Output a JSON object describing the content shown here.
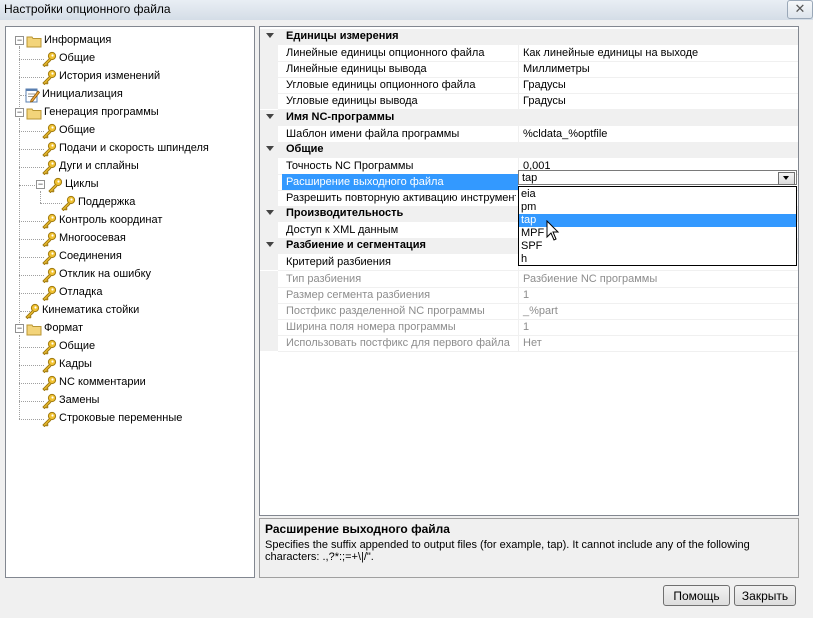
{
  "window": {
    "title": "Настройки опционного файла",
    "close_glyph": "✕"
  },
  "tree": {
    "nodes": [
      {
        "label": "Информация",
        "level": 0,
        "expander": "−",
        "icon": "folder-icon"
      },
      {
        "label": "Общие",
        "level": 1,
        "icon": "key-icon"
      },
      {
        "label": "История изменений",
        "level": 1,
        "icon": "key-icon"
      },
      {
        "label": "Инициализация",
        "level": 0,
        "icon": "notepad-icon"
      },
      {
        "label": "Генерация программы",
        "level": 0,
        "expander": "−",
        "icon": "folder-icon"
      },
      {
        "label": "Общие",
        "level": 1,
        "icon": "key-icon"
      },
      {
        "label": "Подачи и скорость шпинделя",
        "level": 1,
        "icon": "key-icon"
      },
      {
        "label": "Дуги и сплайны",
        "level": 1,
        "icon": "key-icon"
      },
      {
        "label": "Циклы",
        "level": 1,
        "expander": "−",
        "icon": "key-icon"
      },
      {
        "label": "Поддержка",
        "level": 2,
        "icon": "key-icon"
      },
      {
        "label": "Контроль координат",
        "level": 1,
        "icon": "key-icon"
      },
      {
        "label": "Многоосевая",
        "level": 1,
        "icon": "key-icon"
      },
      {
        "label": "Соединения",
        "level": 1,
        "icon": "key-icon"
      },
      {
        "label": "Отклик на ошибку",
        "level": 1,
        "icon": "key-icon"
      },
      {
        "label": "Отладка",
        "level": 1,
        "icon": "key-icon"
      },
      {
        "label": "Кинематика стойки",
        "level": 0,
        "icon": "key-icon"
      },
      {
        "label": "Формат",
        "level": 0,
        "expander": "−",
        "icon": "folder-icon"
      },
      {
        "label": "Общие",
        "level": 1,
        "icon": "key-icon"
      },
      {
        "label": "Кадры",
        "level": 1,
        "icon": "key-icon"
      },
      {
        "label": "NC комментарии",
        "level": 1,
        "icon": "key-icon"
      },
      {
        "label": "Замены",
        "level": 1,
        "icon": "key-icon"
      },
      {
        "label": "Строковые переменные",
        "level": 1,
        "icon": "key-icon"
      }
    ]
  },
  "grid": {
    "rows": [
      {
        "kind": "cat",
        "label": "Единицы измерения"
      },
      {
        "kind": "prop",
        "name": "Линейные единицы опционного файла",
        "value": "Как линейные единицы на выходе"
      },
      {
        "kind": "prop",
        "name": "Линейные единицы вывода",
        "value": "Миллиметры"
      },
      {
        "kind": "prop",
        "name": "Угловые единицы опционного файла",
        "value": "Градусы"
      },
      {
        "kind": "prop",
        "name": "Угловые единицы вывода",
        "value": "Градусы"
      },
      {
        "kind": "cat",
        "label": "Имя NC-программы"
      },
      {
        "kind": "prop",
        "name": "Шаблон имени файла программы",
        "value": "%cldata_%optfile"
      },
      {
        "kind": "cat",
        "label": "Общие"
      },
      {
        "kind": "prop",
        "name": "Точность NC Программы",
        "value": "0,001"
      },
      {
        "kind": "prop",
        "name": "Расширение выходного файла",
        "value": "tap",
        "selected": true
      },
      {
        "kind": "prop",
        "name": "Разрешить повторную активацию инструмента",
        "value": ""
      },
      {
        "kind": "cat",
        "label": "Производительность"
      },
      {
        "kind": "prop",
        "name": "Доступ к XML данным",
        "value": ""
      },
      {
        "kind": "cat",
        "label": "Разбиение и сегментация"
      },
      {
        "kind": "prop",
        "name": "Критерий разбиения",
        "value": ""
      },
      {
        "kind": "prop",
        "name": "Тип разбиения",
        "value": "Разбиение NC программы",
        "disabled": true
      },
      {
        "kind": "prop",
        "name": "Размер сегмента разбиения",
        "value": "1",
        "disabled": true
      },
      {
        "kind": "prop",
        "name": "Постфикс разделенной NC программы",
        "value": "_%part",
        "disabled": true
      },
      {
        "kind": "prop",
        "name": "Ширина поля номера программы",
        "value": "1",
        "disabled": true
      },
      {
        "kind": "prop",
        "name": "Использовать постфикс для первого файла",
        "value": "Нет",
        "disabled": true
      }
    ]
  },
  "combo": {
    "value": "tap",
    "options": [
      "eia",
      "pm",
      "tap",
      "MPF",
      "SPF",
      "h"
    ],
    "selected_index": 2
  },
  "description": {
    "title": "Расширение выходного файла",
    "text": "Specifies the suffix appended to output files (for example, tap). It cannot include any of the following characters: .,?*:;=+\\|/\"."
  },
  "buttons": {
    "help": "Помощь",
    "close": "Закрыть"
  }
}
